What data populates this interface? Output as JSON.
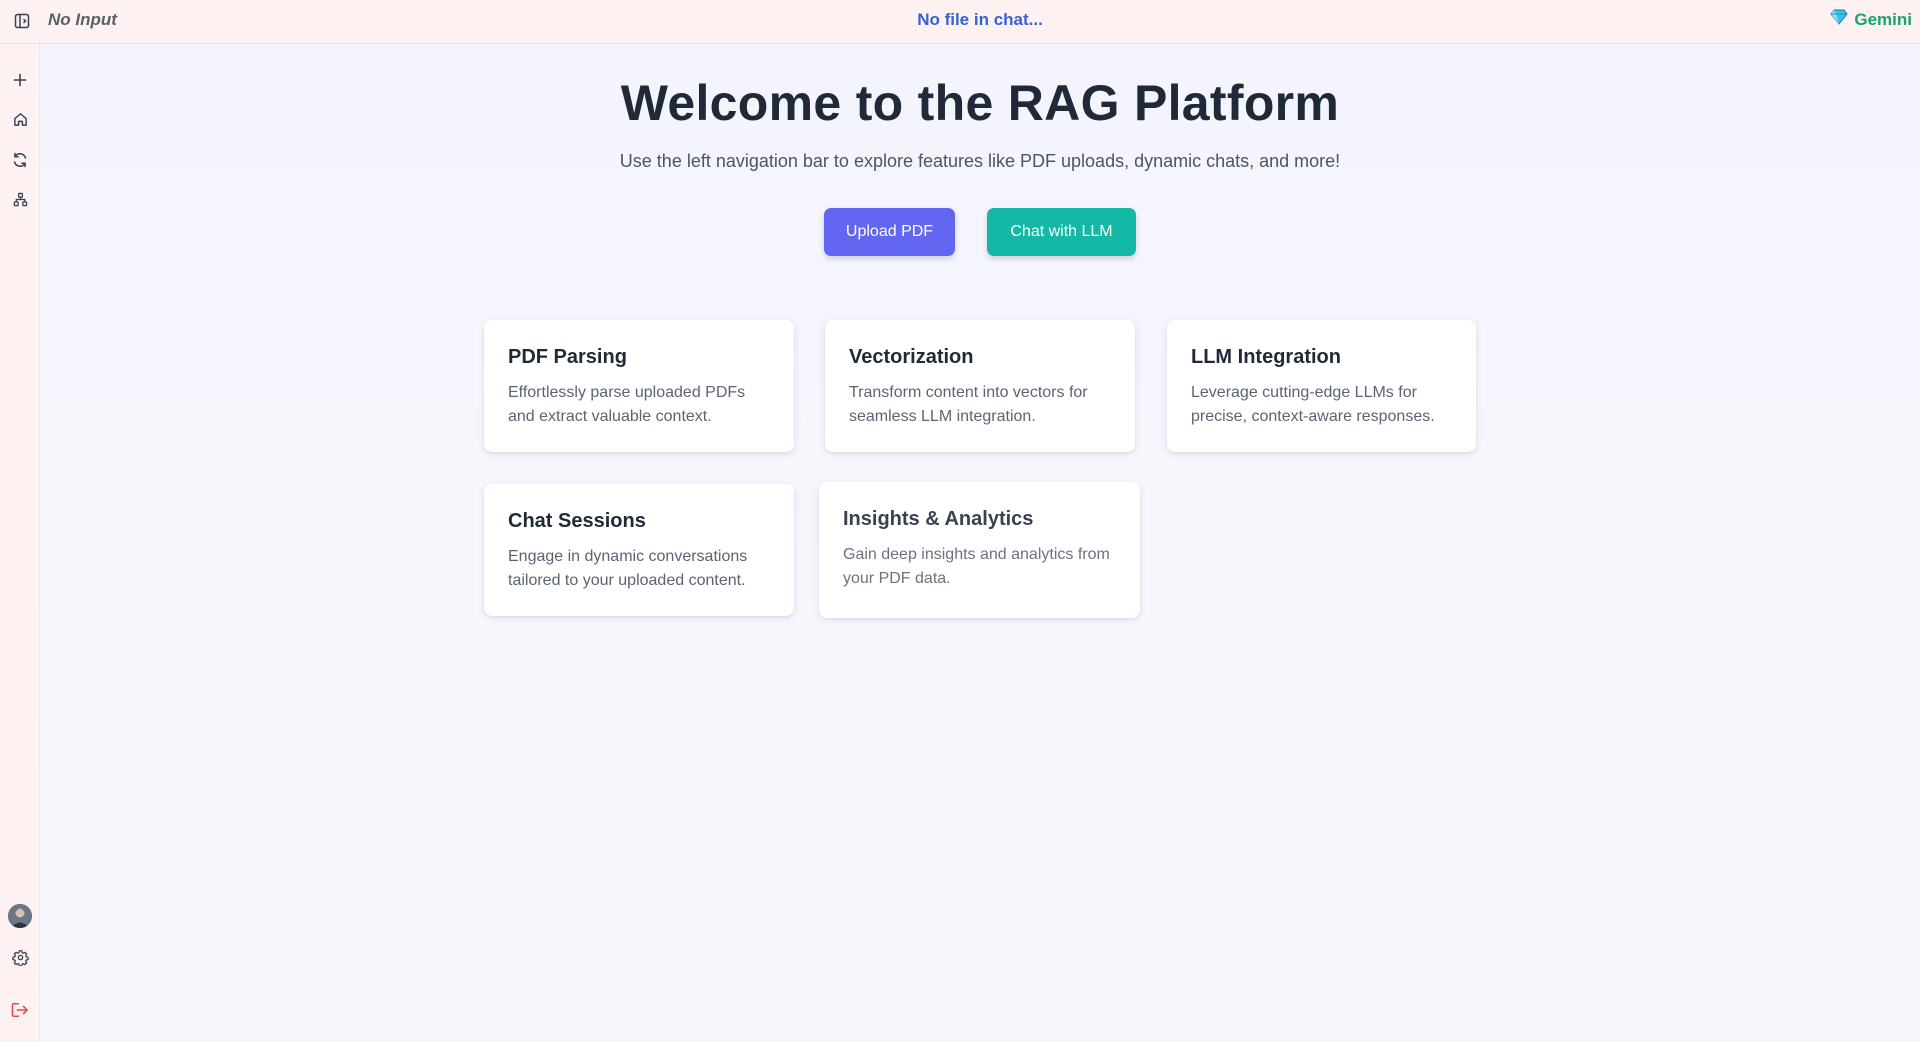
{
  "topbar": {
    "input_status": "No Input",
    "file_status": "No file in chat...",
    "model_label": "Gemini",
    "model_icon": "gem-icon",
    "toggle_icon": "sidebar-toggle-icon"
  },
  "sidebar": {
    "top_items": [
      {
        "name": "new-chat",
        "icon": "plus-icon"
      },
      {
        "name": "home",
        "icon": "home-icon"
      },
      {
        "name": "refresh",
        "icon": "refresh-icon"
      },
      {
        "name": "network",
        "icon": "network-icon"
      }
    ],
    "bottom_items": [
      {
        "name": "profile",
        "icon": "avatar"
      },
      {
        "name": "settings",
        "icon": "gear-icon"
      },
      {
        "name": "logout",
        "icon": "logout-icon"
      }
    ]
  },
  "main": {
    "title": "Welcome to the RAG Platform",
    "subtitle": "Use the left navigation bar to explore features like PDF uploads, dynamic chats, and more!",
    "buttons": {
      "upload_label": "Upload PDF",
      "chat_label": "Chat with LLM"
    },
    "cards": [
      {
        "title": "PDF Parsing",
        "desc": "Effortlessly parse uploaded PDFs and extract valuable context."
      },
      {
        "title": "Vectorization",
        "desc": "Transform content into vectors for seamless LLM integration."
      },
      {
        "title": "LLM Integration",
        "desc": "Leverage cutting-edge LLMs for precise, context-aware responses."
      },
      {
        "title": "Chat Sessions",
        "desc": "Engage in dynamic conversations tailored to your uploaded content."
      },
      {
        "title": "Insights & Analytics",
        "desc": "Gain deep insights and analytics from your PDF data."
      }
    ]
  },
  "colors": {
    "primary": "#6366f1",
    "teal": "#14b8a6",
    "model": "#1aa36a",
    "file_status": "#3662d4",
    "logout": "#e54848"
  }
}
